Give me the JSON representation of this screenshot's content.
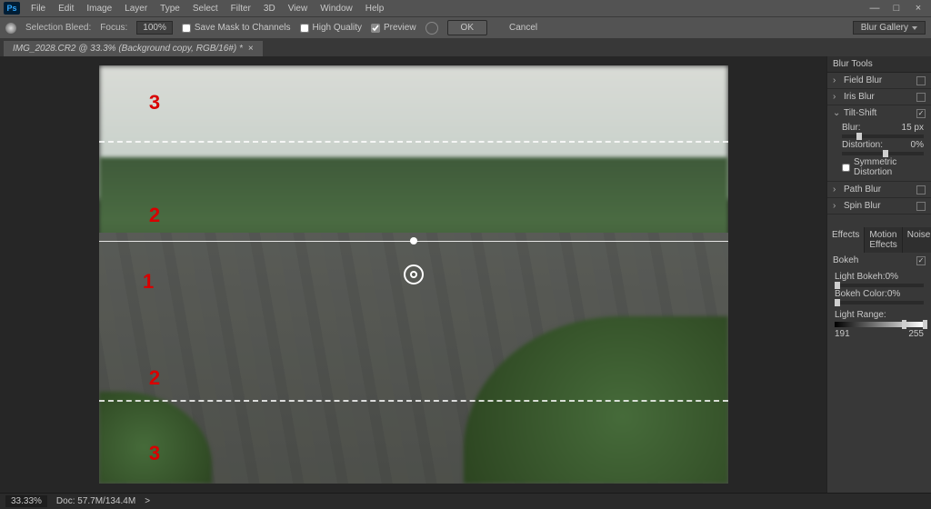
{
  "logo": "Ps",
  "menu": [
    "File",
    "Edit",
    "Image",
    "Layer",
    "Type",
    "Select",
    "Filter",
    "3D",
    "View",
    "Window",
    "Help"
  ],
  "window_controls": [
    "—",
    "□",
    "×"
  ],
  "options": {
    "sel_bleed_label": "Selection Bleed:",
    "focus_label": "Focus:",
    "focus_value": "100%",
    "save_mask": "Save Mask to Channels",
    "high_quality": "High Quality",
    "preview": "Preview",
    "ok": "OK",
    "cancel": "Cancel",
    "mode": "Blur Gallery"
  },
  "doc_tab": "IMG_2028.CR2 @ 33.3% (Background copy, RGB/16#) *",
  "annotations": [
    "3",
    "2",
    "1",
    "2",
    "3"
  ],
  "panels": {
    "tools_title": "Blur Tools",
    "items": [
      {
        "name": "Field Blur",
        "expanded": false,
        "checked": false
      },
      {
        "name": "Iris Blur",
        "expanded": false,
        "checked": false
      },
      {
        "name": "Tilt-Shift",
        "expanded": true,
        "checked": true,
        "params": [
          {
            "label": "Blur:",
            "value": "15 px",
            "pos": 18
          },
          {
            "label": "Distortion:",
            "value": "0%",
            "pos": 50
          }
        ],
        "sym": "Symmetric Distortion"
      },
      {
        "name": "Path Blur",
        "expanded": false,
        "checked": false
      },
      {
        "name": "Spin Blur",
        "expanded": false,
        "checked": false
      }
    ],
    "fx_tabs": [
      "Effects",
      "Motion Effects",
      "Noise"
    ],
    "bokeh": {
      "title": "Bokeh",
      "checked": true,
      "light": {
        "label": "Light Bokeh:",
        "value": "0%",
        "pos": 0
      },
      "color": {
        "label": "Bokeh Color:",
        "value": "0%",
        "pos": 0
      },
      "range": {
        "label": "Light Range:",
        "lo": "191",
        "hi": "255"
      }
    }
  },
  "status": {
    "zoom": "33.33%",
    "doc": "Doc: 57.7M/134.4M",
    "arrow": ">"
  }
}
